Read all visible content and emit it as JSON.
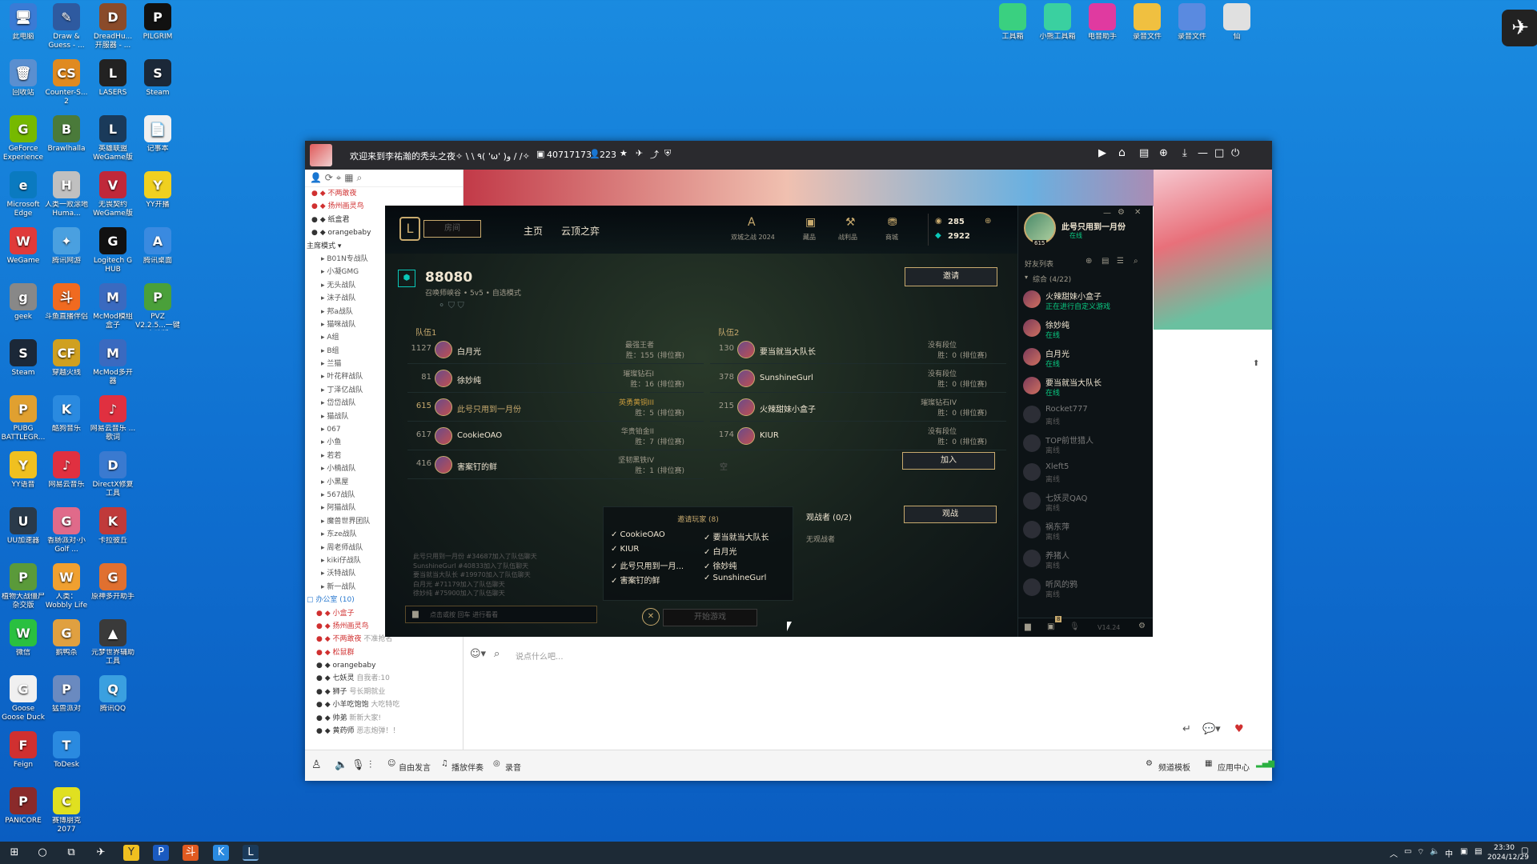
{
  "desktop_left": [
    {
      "label": "此电脑",
      "c": "#3a7bd5",
      "g": "🖥"
    },
    {
      "label": "Draw & Guess - ...",
      "c": "#2e5aa0",
      "g": "✎"
    },
    {
      "label": "DreadHu... 开服器 - ...",
      "c": "#8a4b2a",
      "g": "D"
    },
    {
      "label": "PILGRIM",
      "c": "#111",
      "g": "P"
    },
    {
      "label": "回收站",
      "c": "#5a8fd0",
      "g": "🗑"
    },
    {
      "label": "Counter-S... 2",
      "c": "#e08a20",
      "g": "CS"
    },
    {
      "label": "LASERS",
      "c": "#222",
      "g": "L"
    },
    {
      "label": "Steam",
      "c": "#1b2838",
      "g": "S"
    },
    {
      "label": "GeForce Experience",
      "c": "#76b900",
      "g": "G"
    },
    {
      "label": "Brawlhalla",
      "c": "#4a7a3a",
      "g": "B"
    },
    {
      "label": "英雄联盟 WeGame版",
      "c": "#1a3a5a",
      "g": "L"
    },
    {
      "label": "记事本",
      "c": "#f0f0f0",
      "g": "📄"
    },
    {
      "label": "Microsoft Edge",
      "c": "#0a7ac0",
      "g": "e"
    },
    {
      "label": "人类一败涂地 Huma...",
      "c": "#c0c0c0",
      "g": "H"
    },
    {
      "label": "无畏契约 WeGame版",
      "c": "#c0283a",
      "g": "V"
    },
    {
      "label": "YY开播",
      "c": "#f0d020",
      "g": "Y"
    },
    {
      "label": "WeGame",
      "c": "#e03a3a",
      "g": "W"
    },
    {
      "label": "腾讯网游",
      "c": "#4aa0e0",
      "g": "✦"
    },
    {
      "label": "Logitech G HUB",
      "c": "#111",
      "g": "G"
    },
    {
      "label": "腾讯桌面",
      "c": "#3a8ae0",
      "g": "A"
    },
    {
      "label": "geek",
      "c": "#888",
      "g": "g"
    },
    {
      "label": "斗鱼直播伴侣",
      "c": "#f06a20",
      "g": "斗"
    },
    {
      "label": "McMod模组盒子",
      "c": "#3a6ac0",
      "g": "M"
    },
    {
      "label": "PVZ V2.2.5...一键启动版",
      "c": "#4aa03a",
      "g": "P"
    },
    {
      "label": "Steam",
      "c": "#1b2838",
      "g": "S"
    },
    {
      "label": "穿越火线",
      "c": "#d0a020",
      "g": "CF"
    },
    {
      "label": "McMod多开器",
      "c": "#3a6ac0",
      "g": "M"
    },
    {
      "label": "PUBG BATTLEGR...",
      "c": "#e0a030",
      "g": "P"
    },
    {
      "label": "酷狗音乐",
      "c": "#2a8ae0",
      "g": "K"
    },
    {
      "label": "网易云音乐 ...歌词",
      "c": "#e03040",
      "g": "♪"
    },
    {
      "label": "YY语音",
      "c": "#f0c020",
      "g": "Y"
    },
    {
      "label": "网易云音乐",
      "c": "#e03040",
      "g": "♪"
    },
    {
      "label": "DirectX修复工具",
      "c": "#3a7ad0",
      "g": "D"
    },
    {
      "label": "UU加速器",
      "c": "#2a3a4a",
      "g": "U"
    },
    {
      "label": "香肠派对·小Golf ...",
      "c": "#e06a8a",
      "g": "G"
    },
    {
      "label": "卡拉彼丘",
      "c": "#c03a3a",
      "g": "K"
    },
    {
      "label": "植物大战僵尸杂交版",
      "c": "#5a9a3a",
      "g": "P"
    },
    {
      "label": "人类：Wobbly Life",
      "c": "#f0a030",
      "g": "W"
    },
    {
      "label": "原神多开助手",
      "c": "#e07030",
      "g": "G"
    },
    {
      "label": "微信",
      "c": "#2ac040",
      "g": "W"
    },
    {
      "label": "鹅鸭杀",
      "c": "#e0a040",
      "g": "G"
    },
    {
      "label": "元梦世界辅助工具",
      "c": "#3a3a3a",
      "g": "▲"
    },
    {
      "label": "Goose Goose Duck",
      "c": "#f0f0f0",
      "g": "G"
    },
    {
      "label": "猛兽派对",
      "c": "#6a8ac0",
      "g": "P"
    },
    {
      "label": "腾讯QQ",
      "c": "#3aa0e0",
      "g": "Q"
    },
    {
      "label": "Feign",
      "c": "#d03030",
      "g": "F"
    },
    {
      "label": "ToDesk",
      "c": "#2a8ae0",
      "g": "T"
    },
    {
      "label": "PANICORE",
      "c": "#8a2a2a",
      "g": "P"
    },
    {
      "label": "赛博朋克 2077",
      "c": "#e0e020",
      "g": "C"
    }
  ],
  "desktop_right": [
    {
      "label": "工具箱",
      "c": "#3ad080"
    },
    {
      "label": "小熊工具箱",
      "c": "#3ad0a0"
    },
    {
      "label": "电音助手",
      "c": "#e03aa0"
    },
    {
      "label": "录音文件",
      "c": "#f0c040"
    },
    {
      "label": "录音文件",
      "c": "#5a8ae0"
    },
    {
      "label": "仙",
      "c": "#e0e0e0"
    }
  ],
  "titlebar": {
    "text": "欢迎来到李祐瀚的秃头之夜✧ \\ \\ ٩( 'ω' )و / /✧",
    "channel_id": "40717173",
    "online": "223"
  },
  "yy_tree": {
    "top": [
      "不两敢夜",
      "扬州画灵鸟",
      "纸盒君",
      "orangebaby"
    ],
    "mode": "主席模式",
    "channels": [
      "B01N专战队",
      "小凝GMG",
      "无头战队",
      "沫子战队",
      "邦a战队",
      "猫咪战队",
      "A组",
      "B组",
      "兰猫",
      "叶花秤战队",
      "丁泽亿战队",
      "岱岱战队",
      "猫战队",
      "067",
      "小鱼",
      "若若",
      "小楠战队",
      "小黑屋",
      "567战队",
      "阿猫战队",
      "魔兽世界团队",
      "东ze战队",
      "周老师战队",
      "kiki仔战队",
      "沃特战队",
      "新一战队"
    ],
    "room": "办公室 (10)",
    "members": [
      {
        "n": "小盒子",
        "t": ""
      },
      {
        "n": "扬州画灵鸟",
        "t": ""
      },
      {
        "n": "不两敢夜",
        "t": "不准抢名"
      },
      {
        "n": "松鼠群",
        "t": ""
      },
      {
        "n": "orangebaby",
        "t": ""
      },
      {
        "n": "七妖灵",
        "t": "自我者:10"
      },
      {
        "n": "狮子",
        "t": "号长期就业"
      },
      {
        "n": "小羊吃饱饱",
        "t": "大吃特吃"
      },
      {
        "n": "帅弟",
        "t": "新新大家!"
      },
      {
        "n": "黄药师",
        "t": "恶志炮弹！！"
      }
    ]
  },
  "chat_input_placeholder": "说点什么吧...",
  "bottombar": {
    "free": "自由发言",
    "music": "播放伴奏",
    "record": "录音",
    "channel_template": "频道模板",
    "app_center": "应用中心"
  },
  "lol": {
    "nav": {
      "play": "房间",
      "home": "主页",
      "tft": "云顶之弈",
      "event": "双城之战 2024",
      "collection": "藏品",
      "loot": "战利品",
      "store": "商城"
    },
    "currency": {
      "rp": "285",
      "be": "2922"
    },
    "profile": {
      "name": "此号只用到一月份",
      "status": "在线",
      "level": "615"
    },
    "lobby": {
      "id": "88080",
      "sub": [
        "召唤师峡谷",
        "5v5",
        "自选模式"
      ],
      "invite": "邀请"
    },
    "team1": {
      "label": "队伍1",
      "players": [
        {
          "lv": "1127",
          "name": "白月光",
          "rank": "最强王者",
          "w": "胜：155",
          "p": "(排位赛)"
        },
        {
          "lv": "81",
          "name": "徐妙纯",
          "rank": "璀璨钻石I",
          "w": "胜：16",
          "p": "(排位赛)"
        },
        {
          "lv": "615",
          "name": "此号只用到一月份",
          "rank": "英勇黄铜III",
          "w": "胜：5",
          "p": "(排位赛)",
          "self": true
        },
        {
          "lv": "617",
          "name": "CookieOAO",
          "rank": "华贵铂金II",
          "w": "胜：7",
          "p": "(排位赛)"
        },
        {
          "lv": "416",
          "name": "害案钉的鲜",
          "rank": "坚韧黑铁IV",
          "w": "胜：1",
          "p": "(排位赛)"
        }
      ]
    },
    "team2": {
      "label": "队伍2",
      "players": [
        {
          "lv": "130",
          "name": "要当就当大队长",
          "rank": "没有段位",
          "w": "胜：0",
          "p": "(排位赛)"
        },
        {
          "lv": "378",
          "name": "SunshineGurl",
          "rank": "没有段位",
          "w": "胜：0",
          "p": "(排位赛)"
        },
        {
          "lv": "215",
          "name": "火辣甜妹小盒子",
          "rank": "璀璨钻石IV",
          "w": "胜：0",
          "p": "(排位赛)"
        },
        {
          "lv": "174",
          "name": "KIUR",
          "rank": "没有段位",
          "w": "胜：0",
          "p": "(排位赛)"
        }
      ],
      "empty": "空",
      "join": "加入"
    },
    "chat_log": [
      "此号只用到一月份 #34687加入了队伍聊天",
      "SunshineGurl #40833加入了队伍聊天",
      "要当就当大队长 #19970加入了队伍聊天",
      "白月光 #71179加入了队伍聊天",
      "徐妙纯 #75900加入了队伍聊天"
    ],
    "chat_placeholder": "点击或按 回车 进行看看",
    "invited": {
      "title": "邀请玩家 (8)",
      "col1": [
        "CookieOAO",
        "KIUR",
        "此号只用到一月...",
        "害案钉的鲜"
      ],
      "col2": [
        "要当就当大队长",
        "白月光",
        "徐妙纯",
        "SunshineGurl"
      ]
    },
    "spectators": {
      "title": "观战者 (0/2)",
      "none": "无观战者",
      "btn": "观战"
    },
    "start": "开始游戏",
    "friends": {
      "header": "好友列表",
      "group": "综合 (4/22)",
      "list": [
        {
          "n": "火辣甜妹小盒子",
          "s": "正在进行自定义游戏",
          "on": true
        },
        {
          "n": "徐妙纯",
          "s": "在线",
          "on": true
        },
        {
          "n": "白月光",
          "s": "在线",
          "on": true
        },
        {
          "n": "要当就当大队长",
          "s": "在线",
          "on": true
        },
        {
          "n": "Rocket777",
          "s": "离线",
          "on": false
        },
        {
          "n": "TOP前世猎人",
          "s": "离线",
          "on": false
        },
        {
          "n": "Xleft5",
          "s": "离线",
          "on": false
        },
        {
          "n": "七妖灵QAQ",
          "s": "离线",
          "on": false
        },
        {
          "n": "祸东萍",
          "s": "离线",
          "on": false
        },
        {
          "n": "养猪人",
          "s": "离线",
          "on": false
        },
        {
          "n": "听风的鸦",
          "s": "离线",
          "on": false
        }
      ]
    },
    "version": "V14.24",
    "notif": "8"
  },
  "taskbar": {
    "time": "23:30",
    "date": "2024/12/29",
    "ime": "中"
  }
}
